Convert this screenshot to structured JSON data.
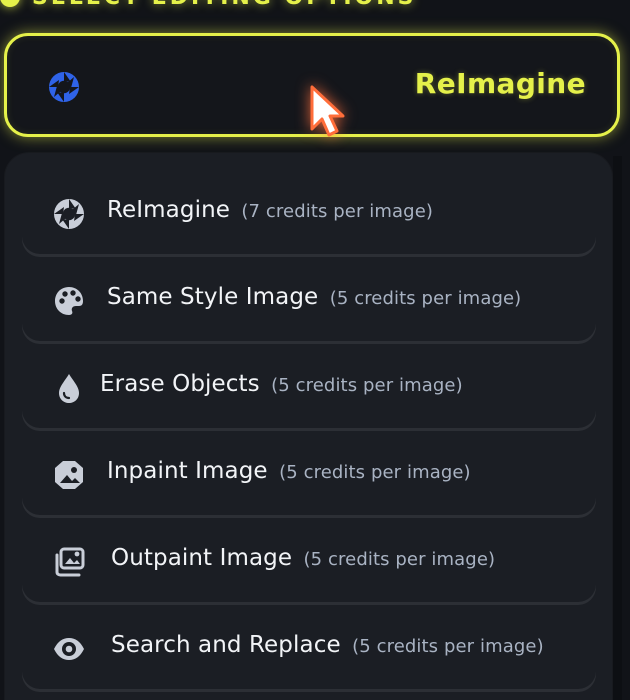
{
  "header": {
    "title": "SELECT EDITING OPTIONS"
  },
  "select": {
    "value": "ReImagine",
    "selected_icon": "aperture-icon",
    "accent_color": "#e5f14a",
    "selected_icon_color": "#2f63e8"
  },
  "dropdown": {
    "items": [
      {
        "label": "ReImagine",
        "credits": "(7 credits per image)",
        "icon": "aperture-icon"
      },
      {
        "label": "Same Style Image",
        "credits": "(5 credits per image)",
        "icon": "palette-icon"
      },
      {
        "label": "Erase Objects",
        "credits": "(5 credits per image)",
        "icon": "droplet-icon"
      },
      {
        "label": "Inpaint Image",
        "credits": "(5 credits per image)",
        "icon": "image-shield-icon"
      },
      {
        "label": "Outpaint Image",
        "credits": "(5 credits per image)",
        "icon": "images-stack-icon"
      },
      {
        "label": "Search and Replace",
        "credits": "(5 credits per image)",
        "icon": "eye-icon"
      }
    ]
  }
}
